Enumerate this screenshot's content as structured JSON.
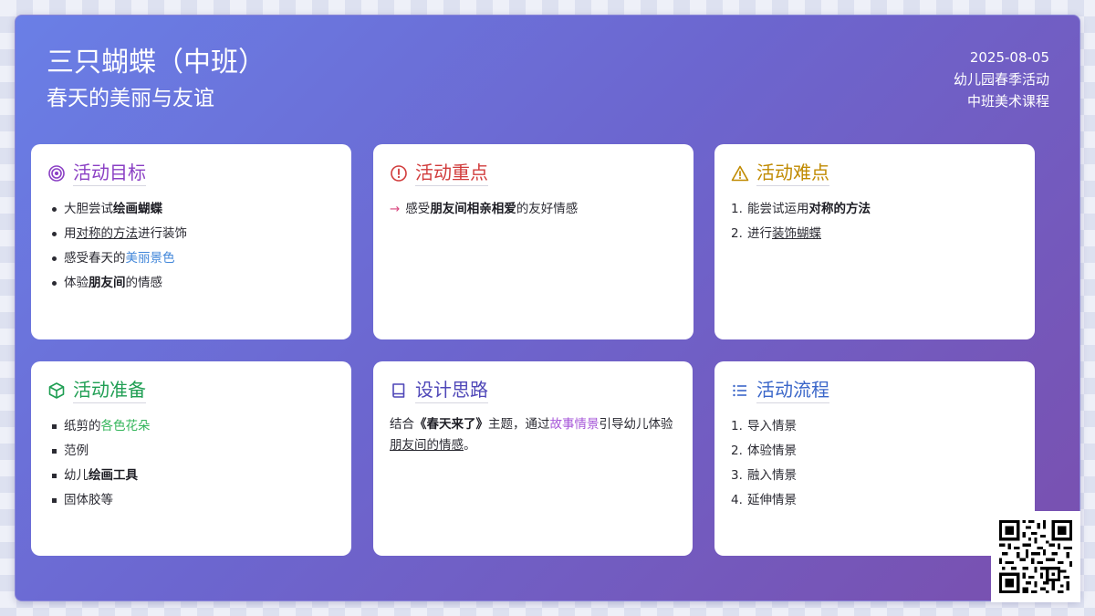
{
  "header": {
    "title": "三只蝴蝶（中班）",
    "subtitle": "春天的美丽与友谊",
    "date": "2025-08-05",
    "category": "幼儿园春季活动",
    "course": "中班美术课程"
  },
  "cards": {
    "goals": {
      "title": "活动目标",
      "icon": "target-icon",
      "items": [
        {
          "pre": "大胆尝试",
          "em": "绘画蝴蝶",
          "post": ""
        },
        {
          "pre": "用",
          "em": "对称的方法",
          "post": "进行装饰"
        },
        {
          "pre": "感受春天的",
          "em": "美丽景色",
          "post": ""
        },
        {
          "pre": "体验",
          "em": "朋友间",
          "post": "的情感"
        }
      ]
    },
    "focus": {
      "title": "活动重点",
      "icon": "alert-circle-icon",
      "arrow": "→",
      "pre": "感受",
      "em": "朋友间相亲相爱",
      "post": "的友好情感"
    },
    "difficulty": {
      "title": "活动难点",
      "icon": "warning-triangle-icon",
      "items": [
        {
          "num": "1.",
          "pre": "能尝试运用",
          "em": "对称的方法"
        },
        {
          "num": "2.",
          "pre": "进行",
          "em": "装饰蝴蝶"
        }
      ]
    },
    "prep": {
      "title": "活动准备",
      "icon": "box-icon",
      "items": [
        {
          "pre": "纸剪的",
          "em": "各色花朵",
          "post": ""
        },
        {
          "pre": "范例",
          "em": "",
          "post": ""
        },
        {
          "pre": "幼儿",
          "em": "绘画工具",
          "post": ""
        },
        {
          "pre": "固体胶等",
          "em": "",
          "post": ""
        }
      ]
    },
    "design": {
      "title": "设计思路",
      "icon": "book-icon",
      "p1": "结合",
      "p2": "《春天来了》",
      "p3": "主题，通过",
      "p4": "故事情景",
      "p5": "引导幼儿体验",
      "p6": "朋友间的情感",
      "p7": "。"
    },
    "flow": {
      "title": "活动流程",
      "icon": "list-icon",
      "items": [
        {
          "num": "1.",
          "text": "导入情景"
        },
        {
          "num": "2.",
          "text": "体验情景"
        },
        {
          "num": "3.",
          "text": "融入情景"
        },
        {
          "num": "4.",
          "text": "延伸情景"
        }
      ]
    }
  },
  "qr": {
    "icon": "qr-code-icon"
  }
}
